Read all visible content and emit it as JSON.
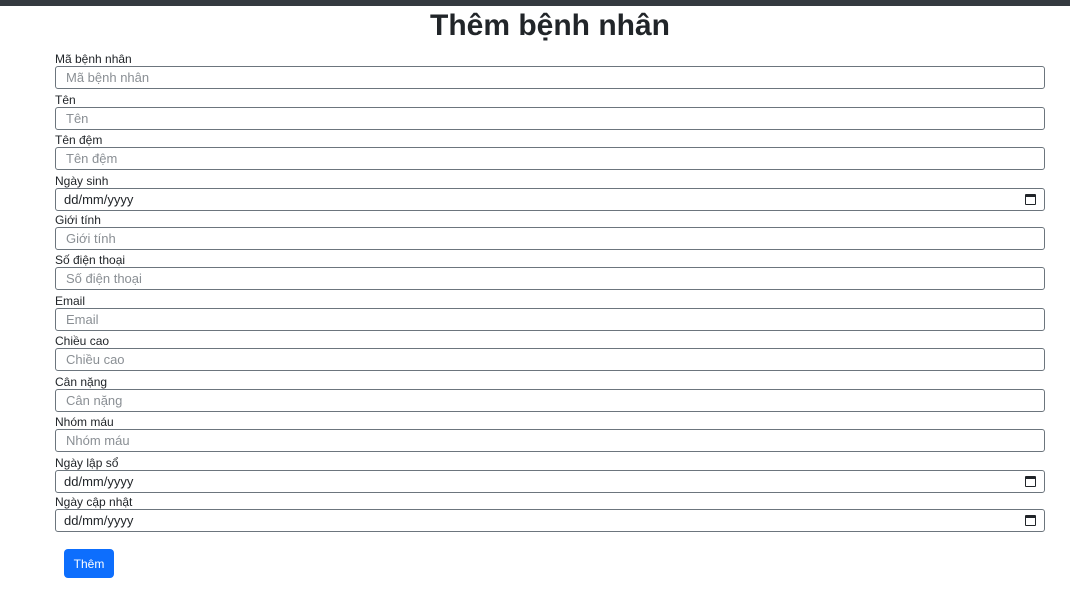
{
  "page": {
    "title": "Thêm bệnh nhân"
  },
  "form": {
    "fields": [
      {
        "label": "Mã bệnh nhân",
        "placeholder": "Mã bệnh nhân",
        "type": "text"
      },
      {
        "label": "Tên",
        "placeholder": "Tên",
        "type": "text"
      },
      {
        "label": "Tên đệm",
        "placeholder": "Tên đệm",
        "type": "text"
      },
      {
        "label": "Ngày sinh",
        "placeholder": "dd/mm/yyyy",
        "type": "date"
      },
      {
        "label": "Giới tính",
        "placeholder": "Giới tính",
        "type": "text"
      },
      {
        "label": "Số điện thoại",
        "placeholder": "Số điện thoại",
        "type": "text"
      },
      {
        "label": "Email",
        "placeholder": "Email",
        "type": "text"
      },
      {
        "label": "Chiều cao",
        "placeholder": "Chiều cao",
        "type": "text"
      },
      {
        "label": "Cân nặng",
        "placeholder": "Cân nặng",
        "type": "text"
      },
      {
        "label": "Nhóm máu",
        "placeholder": "Nhóm máu",
        "type": "text"
      },
      {
        "label": "Ngày lập sổ",
        "placeholder": "dd/mm/yyyy",
        "type": "date"
      },
      {
        "label": "Ngày cập nhật",
        "placeholder": "dd/mm/yyyy",
        "type": "date"
      }
    ],
    "submit_label": "Thêm"
  },
  "colors": {
    "accent": "#0d6efd",
    "topbar": "#343a40"
  },
  "icons": {
    "date_picker": "calendar-icon"
  }
}
